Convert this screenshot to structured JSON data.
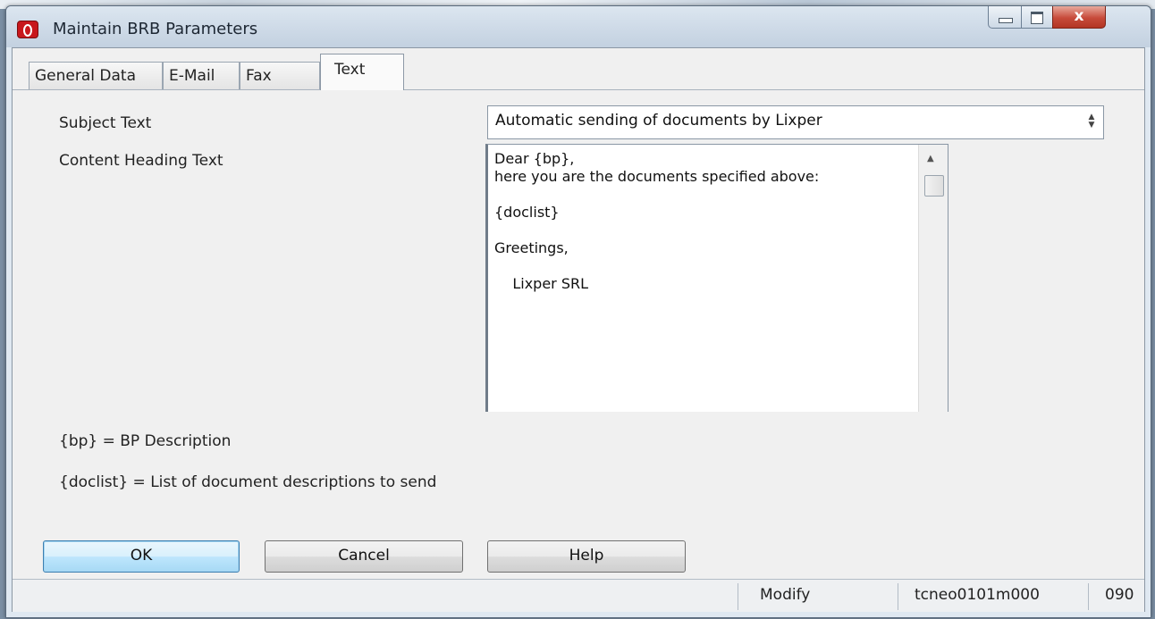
{
  "window": {
    "title": "Maintain BRB Parameters",
    "close_glyph": "x"
  },
  "tabs": [
    {
      "label": "General Data",
      "active": false
    },
    {
      "label": "E-Mail",
      "active": false
    },
    {
      "label": "Fax",
      "active": false
    },
    {
      "label": "Text",
      "active": true
    }
  ],
  "form": {
    "subject_label": "Subject Text",
    "subject_value": "Automatic sending of documents by Lixper",
    "content_label": "Content Heading Text",
    "content_value": "Dear {bp},\nhere you are the documents specified above:\n\n{doclist}\n\nGreetings,\n\n    Lixper SRL"
  },
  "legend": {
    "bp": "{bp} = BP Description",
    "doclist": "{doclist} = List of document descriptions to send"
  },
  "buttons": {
    "ok": "OK",
    "cancel": "Cancel",
    "help": "Help"
  },
  "status": {
    "mode": "Modify",
    "session": "tcneo0101m000",
    "company": "090"
  },
  "colors": {
    "ok_button_accent": "#3c7fb1",
    "close_button": "#c74a3a",
    "app_icon": "#c8171c"
  }
}
